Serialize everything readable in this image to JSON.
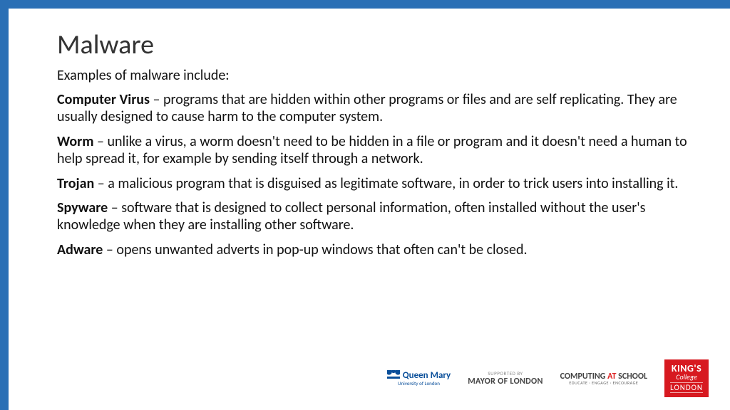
{
  "title": "Malware",
  "subtitle": "Examples of malware include:",
  "items": [
    {
      "term": "Computer Virus",
      "sep": " – ",
      "desc": "programs that are hidden within other programs or files and are self replicating. They are usually designed to cause harm to the computer system."
    },
    {
      "term": "Worm",
      "sep": " – ",
      "desc": "unlike a virus, a worm doesn't need to be hidden in a file or program and it doesn't need a human to help spread it, for example by sending itself through a network."
    },
    {
      "term": "Trojan",
      "sep": " – ",
      "desc": "a malicious program that is disguised as legitimate software, in order to trick users into installing it."
    },
    {
      "term": "Spyware",
      "sep": " – ",
      "desc": "software that is designed to collect personal information, often installed without the user's knowledge when they are installing other software."
    },
    {
      "term": "Adware",
      "sep": " – ",
      "desc": "opens unwanted adverts in pop-up windows that often can't be closed."
    }
  ],
  "logos": {
    "qm": {
      "name": "Queen Mary",
      "sub": "University of London"
    },
    "mayor": {
      "sup": "SUPPORTED BY",
      "main": "MAYOR OF LONDON"
    },
    "cas": {
      "main_pre": "COMPUTING ",
      "main_em": "AT ",
      "main_post": "SCHOOL",
      "sub": "EDUCATE · ENGAGE · ENCOURAGE"
    },
    "kcl": {
      "kings": "KING'S",
      "college": "College",
      "london": "LONDON"
    }
  }
}
